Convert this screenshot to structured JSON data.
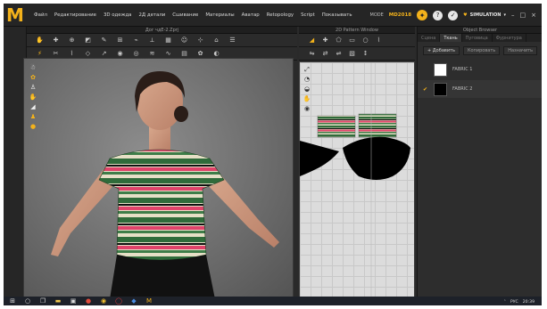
{
  "app": {
    "logo": "M",
    "menu": [
      "Файл",
      "Редактирование",
      "3D одежда",
      "2Д детали",
      "Сшивание",
      "Материалы",
      "Аватар",
      "Retopology",
      "Script",
      "Показывать"
    ],
    "mode_label": "MODE",
    "mode_name": "MD2018",
    "simulation_label": "SIMULATION",
    "window_controls": [
      "–",
      "□",
      "×"
    ]
  },
  "panels": {
    "garment_3d_title": "Дог чдЕ-2.Zprj",
    "pattern_2d_title": "2D Pattern Window",
    "object_browser_title": "Object Browser"
  },
  "object_browser": {
    "tabs": [
      "Сцена",
      "Ткань",
      "Пуговица",
      "Фурнитура"
    ],
    "active_tab": "Ткань",
    "actions": {
      "add": "+ Добавить",
      "copy": "Копировать",
      "assign": "Назначить"
    },
    "fabrics": [
      {
        "name": "FABRIC 1",
        "color": "#ffffff",
        "selected": false
      },
      {
        "name": "FABRIC 2",
        "color": "#000000",
        "selected": true
      }
    ]
  },
  "taskbar": {
    "time": "20:39",
    "lang": "РУС"
  },
  "icons": {
    "windows": "windows-icon",
    "search": "search-icon",
    "task_view": "task-view-icon"
  },
  "colors": {
    "accent": "#f3b21b",
    "stripe_green": "#2f6b3a",
    "stripe_pink": "#e0436a",
    "stripe_cream": "#e6dfc6"
  }
}
